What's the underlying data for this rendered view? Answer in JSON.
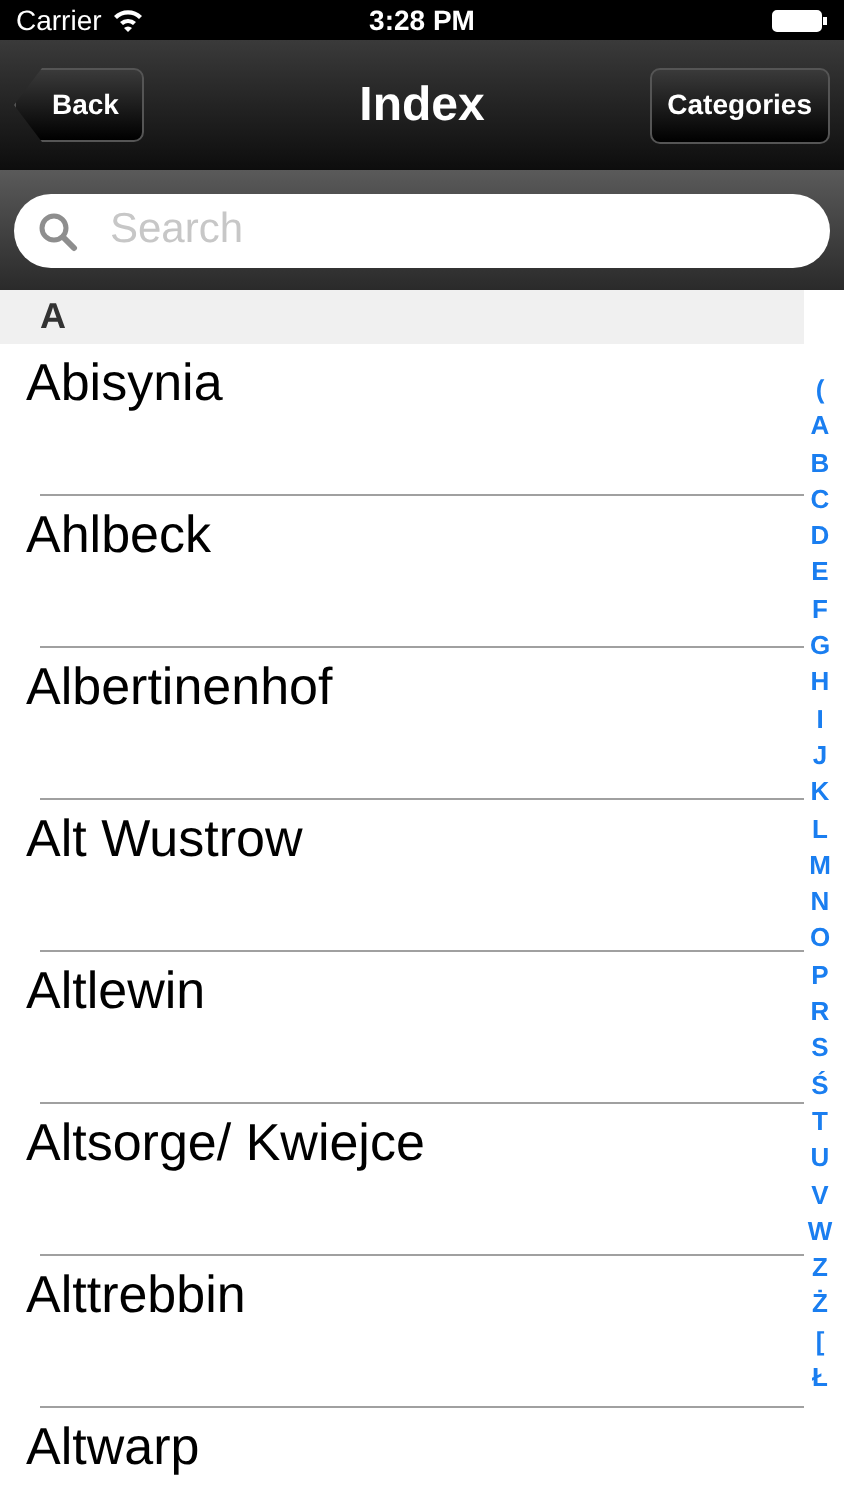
{
  "status_bar": {
    "carrier": "Carrier",
    "time": "3:28 PM"
  },
  "nav_bar": {
    "back": "Back",
    "title": "Index",
    "right_button": "Categories"
  },
  "search": {
    "placeholder": "Search"
  },
  "sections": [
    {
      "header": "A",
      "rows": [
        "Abisynia",
        "Ahlbeck",
        "Albertinenhof",
        "Alt Wustrow",
        "Altlewin",
        "Altsorge/ Kwiejce",
        "Alttrebbin",
        "Altwarp"
      ]
    }
  ],
  "index_letters": [
    "(",
    "A",
    "B",
    "C",
    "D",
    "E",
    "F",
    "G",
    "H",
    "I",
    "J",
    "K",
    "L",
    "M",
    "N",
    "O",
    "P",
    "R",
    "S",
    "Ś",
    "T",
    "U",
    "V",
    "W",
    "Z",
    "Ż",
    "[",
    "Ł"
  ]
}
